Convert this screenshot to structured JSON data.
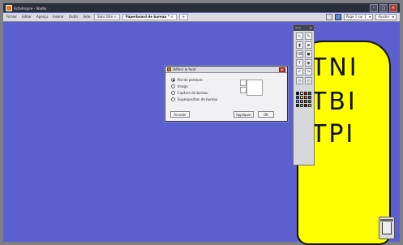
{
  "window": {
    "title": "ActivInspire - Studio",
    "controls": {
      "minimize": "–",
      "maximize": "□",
      "close": "×"
    }
  },
  "menubar": {
    "items": [
      "Fichier",
      "Editer",
      "Aperçu",
      "Insérer",
      "Outils",
      "Aide"
    ],
    "tabs": [
      {
        "label": "Sans titre",
        "active": false
      },
      {
        "label": "Paperboard de bureau *",
        "active": true
      }
    ],
    "tab_close": "×",
    "add_tab": "+",
    "right": {
      "page_label": "Page 1 sur 1",
      "zoom_label": "Ajuster",
      "caret": "▼"
    }
  },
  "canvas": {
    "handwriting": [
      "TNI",
      "TBI",
      "TPI"
    ],
    "background_color": "#5b5fcf",
    "shape_color": "#ffff00"
  },
  "dialog": {
    "title": "Définir le fond",
    "close": "×",
    "options": [
      {
        "label": "Pot de peinture",
        "selected": true
      },
      {
        "label": "Image",
        "selected": false
      },
      {
        "label": "Capture de bureau",
        "selected": false
      },
      {
        "label": "Superposition de bureau",
        "selected": false
      }
    ],
    "buttons": {
      "cancel": "Annuler",
      "apply": "Appliquer",
      "ok": "OK"
    }
  },
  "toolbar": {
    "icons": [
      "select-icon",
      "pen-icon",
      "marker-icon",
      "highlighter-icon",
      "eraser-icon",
      "shape-icon",
      "text-icon",
      "fill-icon",
      "undo-icon",
      "redo-icon",
      "camera-icon",
      "timer-icon"
    ],
    "palette": [
      "#000000",
      "#ffffff",
      "#ff0000",
      "#00a000",
      "#0050ff",
      "#ffff00",
      "#ff8c00",
      "#8a2be2",
      "#00c8ff",
      "#ff66cc",
      "#a0522d",
      "#808080",
      "#003366",
      "#66cc66",
      "#990000",
      "#cccc00"
    ]
  },
  "trash": {
    "icon": "trash-icon"
  }
}
